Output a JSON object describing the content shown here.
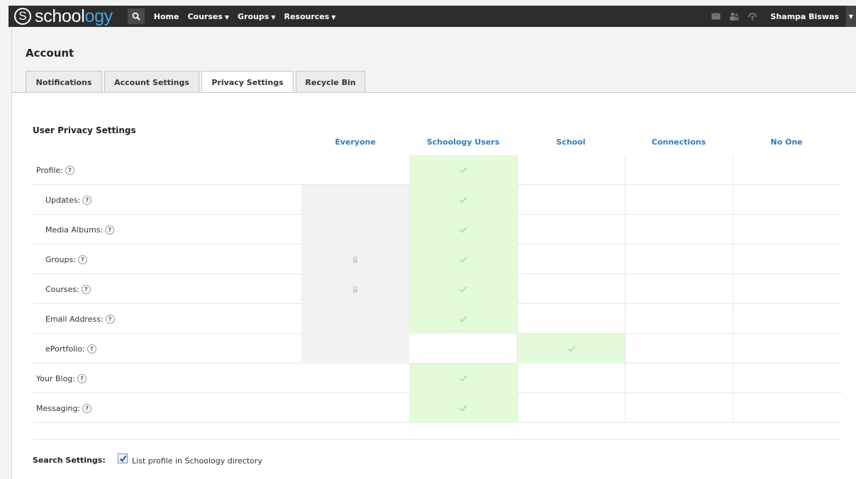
{
  "app": {
    "logo_letter": "S",
    "logo_text_main": "school",
    "logo_text_accent": "ogy",
    "logo_mark": "®"
  },
  "nav": {
    "items": [
      {
        "label": "Home",
        "dropdown": false
      },
      {
        "label": "Courses",
        "dropdown": true
      },
      {
        "label": "Groups",
        "dropdown": true
      },
      {
        "label": "Resources",
        "dropdown": true
      }
    ],
    "user_name": "Shampa Biswas",
    "icons": [
      "search-icon",
      "messages-icon",
      "requests-icon",
      "notifications-icon"
    ]
  },
  "page": {
    "title": "Account",
    "tabs": [
      {
        "label": "Notifications",
        "active": false
      },
      {
        "label": "Account Settings",
        "active": false
      },
      {
        "label": "Privacy Settings",
        "active": true
      },
      {
        "label": "Recycle Bin",
        "active": false
      }
    ]
  },
  "privacy": {
    "section_title": "User Privacy Settings",
    "columns": [
      "Everyone",
      "Schoology Users",
      "School",
      "Connections",
      "No One"
    ],
    "rows": [
      {
        "label": "Profile:",
        "indent": false,
        "selected": 1,
        "everyone_locked": false,
        "everyone_lock_icon": false
      },
      {
        "label": "Updates:",
        "indent": true,
        "selected": 1,
        "everyone_locked": true,
        "everyone_lock_icon": false
      },
      {
        "label": "Media Albums:",
        "indent": true,
        "selected": 1,
        "everyone_locked": true,
        "everyone_lock_icon": false
      },
      {
        "label": "Groups:",
        "indent": true,
        "selected": 1,
        "everyone_locked": true,
        "everyone_lock_icon": true
      },
      {
        "label": "Courses:",
        "indent": true,
        "selected": 1,
        "everyone_locked": true,
        "everyone_lock_icon": true
      },
      {
        "label": "Email Address:",
        "indent": true,
        "selected": 1,
        "everyone_locked": true,
        "everyone_lock_icon": false
      },
      {
        "label": "ePortfolio:",
        "indent": true,
        "selected": 2,
        "everyone_locked": true,
        "everyone_lock_icon": false
      },
      {
        "label": "Your Blog:",
        "indent": false,
        "selected": 1,
        "everyone_locked": false,
        "everyone_lock_icon": false
      },
      {
        "label": "Messaging:",
        "indent": false,
        "selected": 1,
        "everyone_locked": false,
        "everyone_lock_icon": false
      }
    ],
    "help_glyph": "?"
  },
  "search_settings": {
    "label": "Search Settings:",
    "option_label": "List profile in Schoology directory",
    "checked": true
  },
  "colors": {
    "topbar": "#2c2c2c",
    "accent_blue": "#2f7bc0",
    "logo_blue": "#4aa3df",
    "selected_cell": "#e3fbdb",
    "locked_cell": "#f2f2f2",
    "check_green": "#b7e6a8"
  }
}
